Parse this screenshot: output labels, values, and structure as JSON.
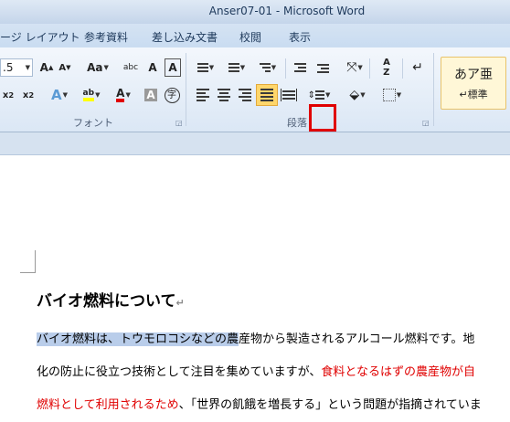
{
  "window": {
    "title": "Anser07-01 - Microsoft Word"
  },
  "tabs": [
    "ージ レイアウト",
    "参考資料",
    "差し込み文書",
    "校閲",
    "表示"
  ],
  "ribbon": {
    "font_size": ".5",
    "font_group_label": "フォント",
    "paragraph_group_label": "段落",
    "style_sample": "あア亜",
    "style_name": "↵標準",
    "accent_color": "#e00000",
    "highlight_color": "#ffff00"
  },
  "document": {
    "heading": "バイオ燃料について",
    "line1_selected": "バイオ燃料は、トウモロコシなどの農",
    "line1_rest": "産物から製造されるアルコール燃料です。地",
    "line2_normal": "化の防止に役立つ技術として注目を集めていますが、",
    "line2_red": "食料となるはずの農産物が自",
    "line3_red": "燃料として利用されるため",
    "line3_normal": "、「世界の飢餓を増長する」という問題が指摘されていま"
  }
}
